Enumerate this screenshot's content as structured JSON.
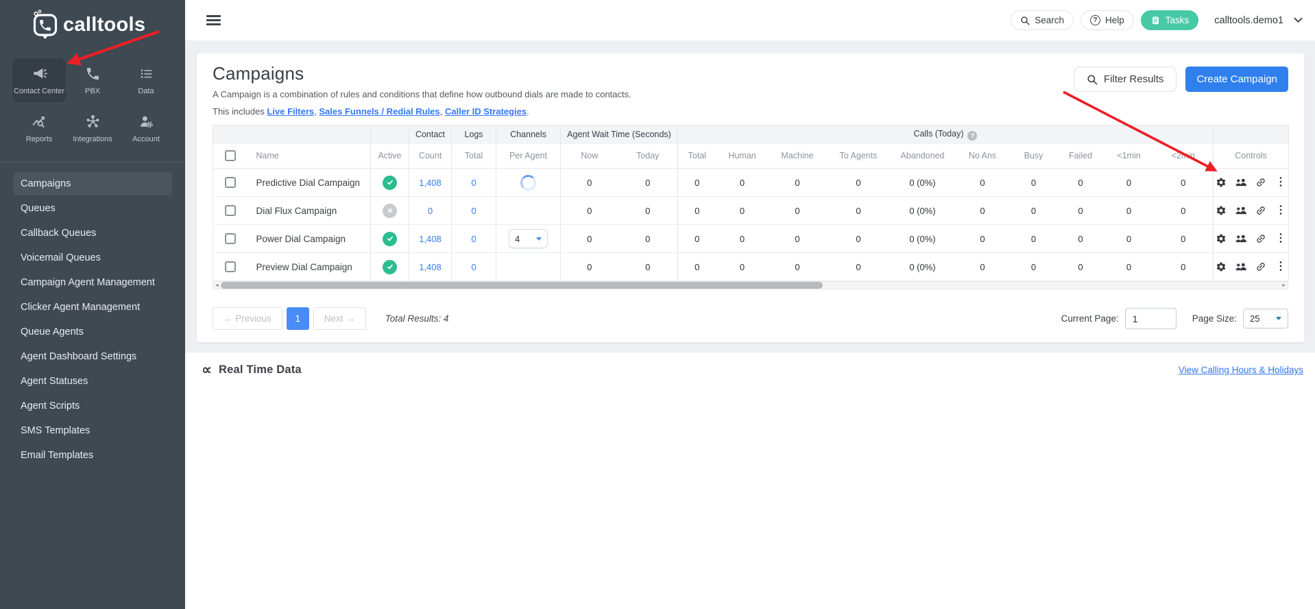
{
  "sidebar": {
    "logo_text": "calltools",
    "apps": [
      {
        "label": "Contact Center",
        "icon": "megaphone",
        "active": true
      },
      {
        "label": "PBX",
        "icon": "phone-handset",
        "active": false
      },
      {
        "label": "Data",
        "icon": "list",
        "active": false
      },
      {
        "label": "Reports",
        "icon": "chart-magnifier",
        "active": false
      },
      {
        "label": "Integrations",
        "icon": "network-hub",
        "active": false
      },
      {
        "label": "Account",
        "icon": "user-gear",
        "active": false
      }
    ],
    "menu": [
      {
        "label": "Campaigns",
        "active": true
      },
      {
        "label": "Queues",
        "active": false
      },
      {
        "label": "Callback Queues",
        "active": false
      },
      {
        "label": "Voicemail Queues",
        "active": false
      },
      {
        "label": "Campaign Agent Management",
        "active": false
      },
      {
        "label": "Clicker Agent Management",
        "active": false
      },
      {
        "label": "Queue Agents",
        "active": false
      },
      {
        "label": "Agent Dashboard Settings",
        "active": false
      },
      {
        "label": "Agent Statuses",
        "active": false
      },
      {
        "label": "Agent Scripts",
        "active": false
      },
      {
        "label": "SMS Templates",
        "active": false
      },
      {
        "label": "Email Templates",
        "active": false
      }
    ]
  },
  "topbar": {
    "search_label": "Search",
    "help_label": "Help",
    "help_icon_glyph": "?",
    "tasks_label": "Tasks",
    "account_name": "calltools.demo1"
  },
  "page": {
    "title": "Campaigns",
    "description": "A Campaign is a combination of rules and conditions that define how outbound dials are made to contacts.",
    "includes_prefix": "This includes ",
    "links": [
      "Live Filters",
      "Sales Funnels / Redial Rules",
      "Caller ID Strategies"
    ],
    "sep": ", ",
    "suffix": ".",
    "filter_button": "Filter Results",
    "create_button": "Create Campaign"
  },
  "table": {
    "group_headers": {
      "contact": "Contact",
      "logs": "Logs",
      "channels": "Channels",
      "agent_wait": "Agent Wait Time (Seconds)",
      "calls": "Calls (Today)"
    },
    "info_icon_glyph": "?",
    "sub_headers": [
      "Name",
      "Active",
      "Count",
      "Total",
      "Per Agent",
      "Now",
      "Today",
      "Total",
      "Human",
      "Machine",
      "To Agents",
      "Abandoned",
      "No Ans",
      "Busy",
      "Failed",
      "<1min",
      "<2min",
      "Controls"
    ],
    "controls_icons": [
      "gear",
      "people",
      "link",
      "kebab"
    ],
    "rows": [
      {
        "name": "Predictive Dial Campaign",
        "active": true,
        "contact_count": "1,408",
        "logs_total": "0",
        "per_agent_type": "spinner",
        "per_agent_value": "",
        "now": "0",
        "today": "0",
        "calls_total": "0",
        "human": "0",
        "machine": "0",
        "to_agents": "0",
        "abandoned": "0 (0%)",
        "no_ans": "0",
        "busy": "0",
        "failed": "0",
        "under_1min": "0",
        "under_2min": "0"
      },
      {
        "name": "Dial Flux Campaign",
        "active": false,
        "contact_count": "0",
        "logs_total": "0",
        "per_agent_type": "none",
        "per_agent_value": "",
        "now": "0",
        "today": "0",
        "calls_total": "0",
        "human": "0",
        "machine": "0",
        "to_agents": "0",
        "abandoned": "0 (0%)",
        "no_ans": "0",
        "busy": "0",
        "failed": "0",
        "under_1min": "0",
        "under_2min": "0"
      },
      {
        "name": "Power Dial Campaign",
        "active": true,
        "contact_count": "1,408",
        "logs_total": "0",
        "per_agent_type": "select",
        "per_agent_value": "4",
        "now": "0",
        "today": "0",
        "calls_total": "0",
        "human": "0",
        "machine": "0",
        "to_agents": "0",
        "abandoned": "0 (0%)",
        "no_ans": "0",
        "busy": "0",
        "failed": "0",
        "under_1min": "0",
        "under_2min": "0"
      },
      {
        "name": "Preview Dial Campaign",
        "active": true,
        "contact_count": "1,408",
        "logs_total": "0",
        "per_agent_type": "none",
        "per_agent_value": "",
        "now": "0",
        "today": "0",
        "calls_total": "0",
        "human": "0",
        "machine": "0",
        "to_agents": "0",
        "abandoned": "0 (0%)",
        "no_ans": "0",
        "busy": "0",
        "failed": "0",
        "under_1min": "0",
        "under_2min": "0"
      }
    ]
  },
  "pagination": {
    "previous": "← Previous",
    "page": "1",
    "next": "Next →",
    "total_results": "Total Results: 4",
    "current_page_label": "Current Page:",
    "current_page_value": "1",
    "page_size_label": "Page Size:",
    "page_size_value": "25"
  },
  "realtime": {
    "title": "Real Time Data",
    "link": "View Calling Hours & Holidays"
  },
  "icons": {
    "kebab_glyph": "⋮",
    "realtime_glyph": "∝",
    "scroll_left_glyph": "◄",
    "scroll_right_glyph": "►"
  },
  "colors": {
    "sidebar_bg": "#3e4952",
    "accent_blue": "#2f80ed",
    "link_blue": "#3478f6",
    "tasks_teal": "#47c9a6",
    "active_green": "#2bbd8e",
    "inactive_gray": "#c7cbce",
    "annotation_red": "#ec1f27"
  }
}
